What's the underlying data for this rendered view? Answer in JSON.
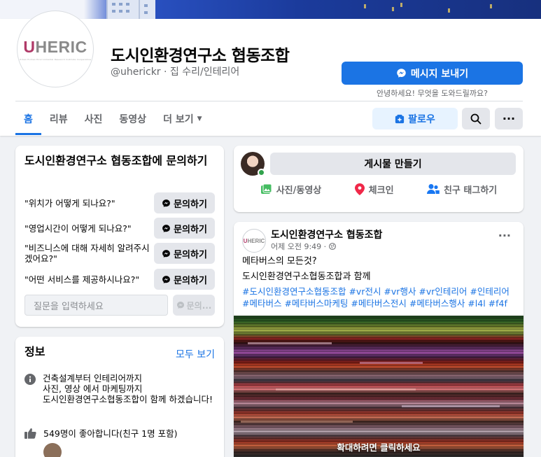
{
  "page": {
    "name": "도시인환경연구소 협동조합",
    "handle_category": "@uherickr · 집 수리/인테리어",
    "logo_text_u": "U",
    "logo_text_rest": "HERIC",
    "logo_subtitle": "Urban Human Environmental Research Institute Cooperative"
  },
  "header": {
    "message_button": "메시지 보내기",
    "message_hint": "안녕하세요! 무엇을 도와드릴까요?",
    "follow_button": "팔로우",
    "tabs": [
      {
        "label": "홈",
        "active": true
      },
      {
        "label": "리뷰"
      },
      {
        "label": "사진"
      },
      {
        "label": "동영상"
      },
      {
        "label": "더 보기"
      }
    ]
  },
  "ask": {
    "title": "도시인환경연구소 협동조합에 문의하기",
    "questions": [
      "\"위치가 어떻게 되나요?\"",
      "\"영업시간이 어떻게 되나요?\"",
      "\"비즈니스에 대해 자세히 알려주시겠어요?\"",
      "\"어떤 서비스를 제공하시나요?\""
    ],
    "ask_button": "문의하기",
    "input_placeholder": "질문을 입력하세요",
    "send_button": "문의..."
  },
  "intro": {
    "title": "정보",
    "see_all": "모두 보기",
    "description": "건축설계부터 인테리어까지\n사진, 영상 에서 마케팅까지\n도시인환경연구소협동조합이 함께 하겠습니다!",
    "likes": "549명이 좋아합니다(친구 1명 포함)"
  },
  "composer": {
    "create_post": "게시물 만들기",
    "actions": [
      "사진/동영상",
      "체크인",
      "친구 태그하기"
    ]
  },
  "post": {
    "author": "도시인환경연구소 협동조합",
    "time": "어제 오전 9:49 · ",
    "line1": "메타버스의 모든것?",
    "line2": "도시인환경연구소협동조합과 함께",
    "hashtags": "#도시인환경연구소협동조합 #vr전시 #vr행사 #vr인테리어 #인테리어 #메타버스 #메타버스마케팅 #메타버스전시 #메타버스행사 #l4l #f4f",
    "image_hint": "확대하려면 클릭하세요"
  },
  "colors": {
    "brand_blue": "#1b74e4",
    "logo_accent": "#b03a68",
    "online_green": "#31a24c",
    "checkin_red": "#f02849",
    "photo_green": "#45bd62"
  }
}
